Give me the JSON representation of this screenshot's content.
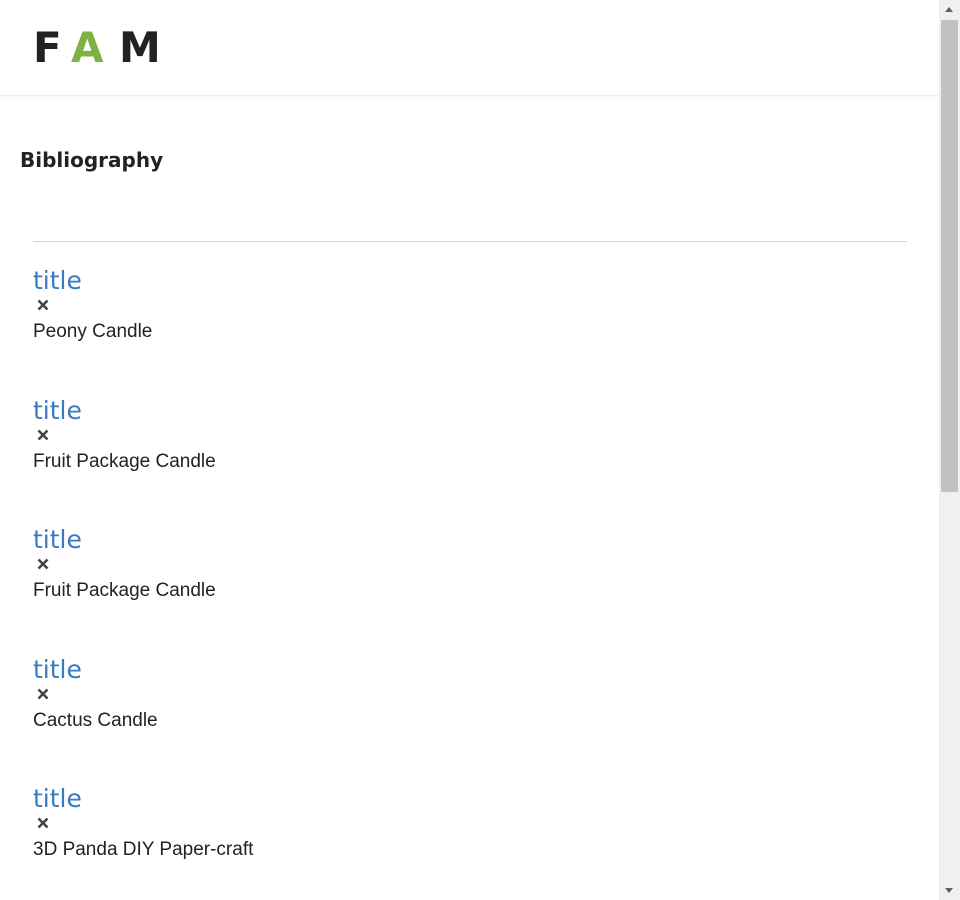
{
  "logo": {
    "letters": [
      "F",
      "A",
      "M"
    ],
    "accent_color": "#7cb342"
  },
  "page_title": "Bibliography",
  "items": [
    {
      "title": "title",
      "name": "Peony Candle",
      "remove_icon": "close-icon"
    },
    {
      "title": "title",
      "name": "Fruit Package Candle",
      "remove_icon": "close-icon"
    },
    {
      "title": "title",
      "name": "Fruit Package Candle",
      "remove_icon": "close-icon"
    },
    {
      "title": "title",
      "name": "Cactus Candle",
      "remove_icon": "close-icon"
    },
    {
      "title": "title",
      "name": "3D Panda DIY Paper-craft",
      "remove_icon": "close-icon"
    }
  ],
  "colors": {
    "link": "#3a7bbf",
    "text": "#222222"
  }
}
